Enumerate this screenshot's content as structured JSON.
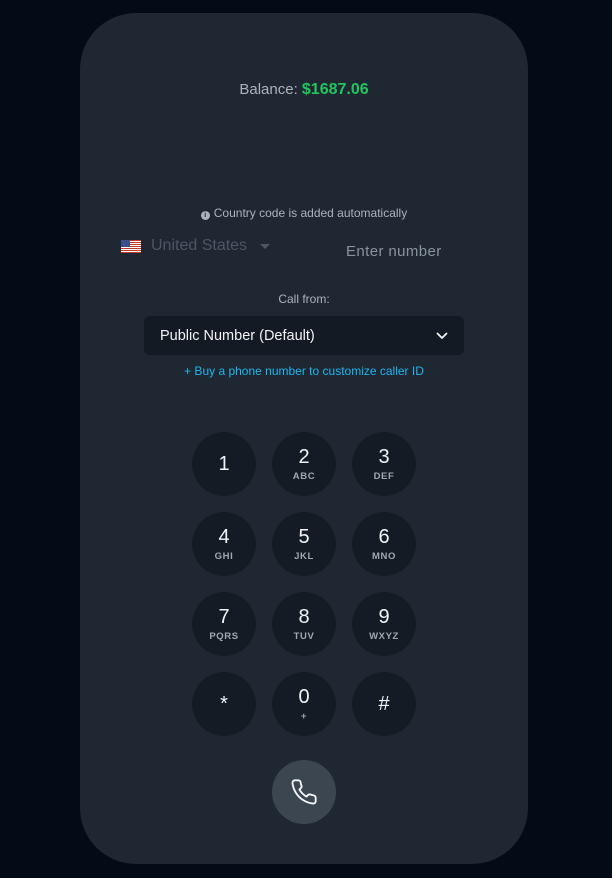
{
  "balance": {
    "label": "Balance:",
    "amount": "$1687.06",
    "amount_color": "#22c55e"
  },
  "notice": {
    "icon": "info-icon",
    "text": "Country code is added automatically"
  },
  "country": {
    "flag_icon": "us-flag-icon",
    "name": "United States"
  },
  "phone_number": {
    "value": "",
    "placeholder": "Enter number"
  },
  "call_from": {
    "label": "Call from:",
    "selected": "Public Number (Default)"
  },
  "buy_link": "+ Buy a phone number to customize caller ID",
  "keypad": [
    {
      "digit": "1",
      "letters": ""
    },
    {
      "digit": "2",
      "letters": "ABC"
    },
    {
      "digit": "3",
      "letters": "DEF"
    },
    {
      "digit": "4",
      "letters": "GHI"
    },
    {
      "digit": "5",
      "letters": "JKL"
    },
    {
      "digit": "6",
      "letters": "MNO"
    },
    {
      "digit": "7",
      "letters": "PQRS"
    },
    {
      "digit": "8",
      "letters": "TUV"
    },
    {
      "digit": "9",
      "letters": "WXYZ"
    },
    {
      "digit": "*",
      "letters": ""
    },
    {
      "digit": "0",
      "letters": "+"
    },
    {
      "digit": "#",
      "letters": ""
    }
  ],
  "call_button": {
    "icon": "phone-icon"
  }
}
